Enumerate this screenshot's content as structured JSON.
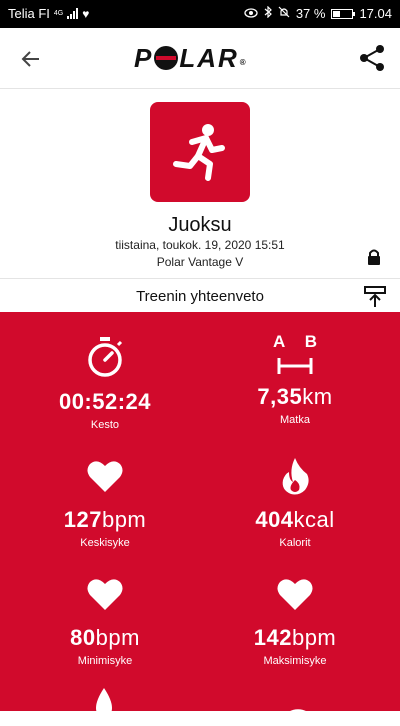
{
  "status_bar": {
    "carrier": "Telia FI",
    "network": "4G",
    "battery": "37 %",
    "time": "17.04"
  },
  "header": {
    "logo": "POLAR"
  },
  "activity": {
    "sport": "Juoksu",
    "datetime": "tiistaina, toukok. 19, 2020 15:51",
    "device": "Polar Vantage V"
  },
  "summary_label": "Treenin yhteenveto",
  "stats": [
    {
      "value": "00:52:24",
      "unit": "",
      "label": "Kesto",
      "icon": "stopwatch-icon"
    },
    {
      "value": "7,35",
      "unit": "km",
      "label": "Matka",
      "icon": "distance-ab-icon",
      "icon_text_a": "A",
      "icon_text_b": "B"
    },
    {
      "value": "127",
      "unit": "bpm",
      "label": "Keskisyke",
      "icon": "heart-icon"
    },
    {
      "value": "404",
      "unit": "kcal",
      "label": "Kalorit",
      "icon": "flame-icon"
    },
    {
      "value": "80",
      "unit": "bpm",
      "label": "Minimisyke",
      "icon": "heart-icon"
    },
    {
      "value": "142",
      "unit": "bpm",
      "label": "Maksimisyke",
      "icon": "heart-icon"
    }
  ],
  "colors": {
    "polar_red": "#d10a2c",
    "status_bg": "#000000"
  },
  "battery_level": 0.37
}
